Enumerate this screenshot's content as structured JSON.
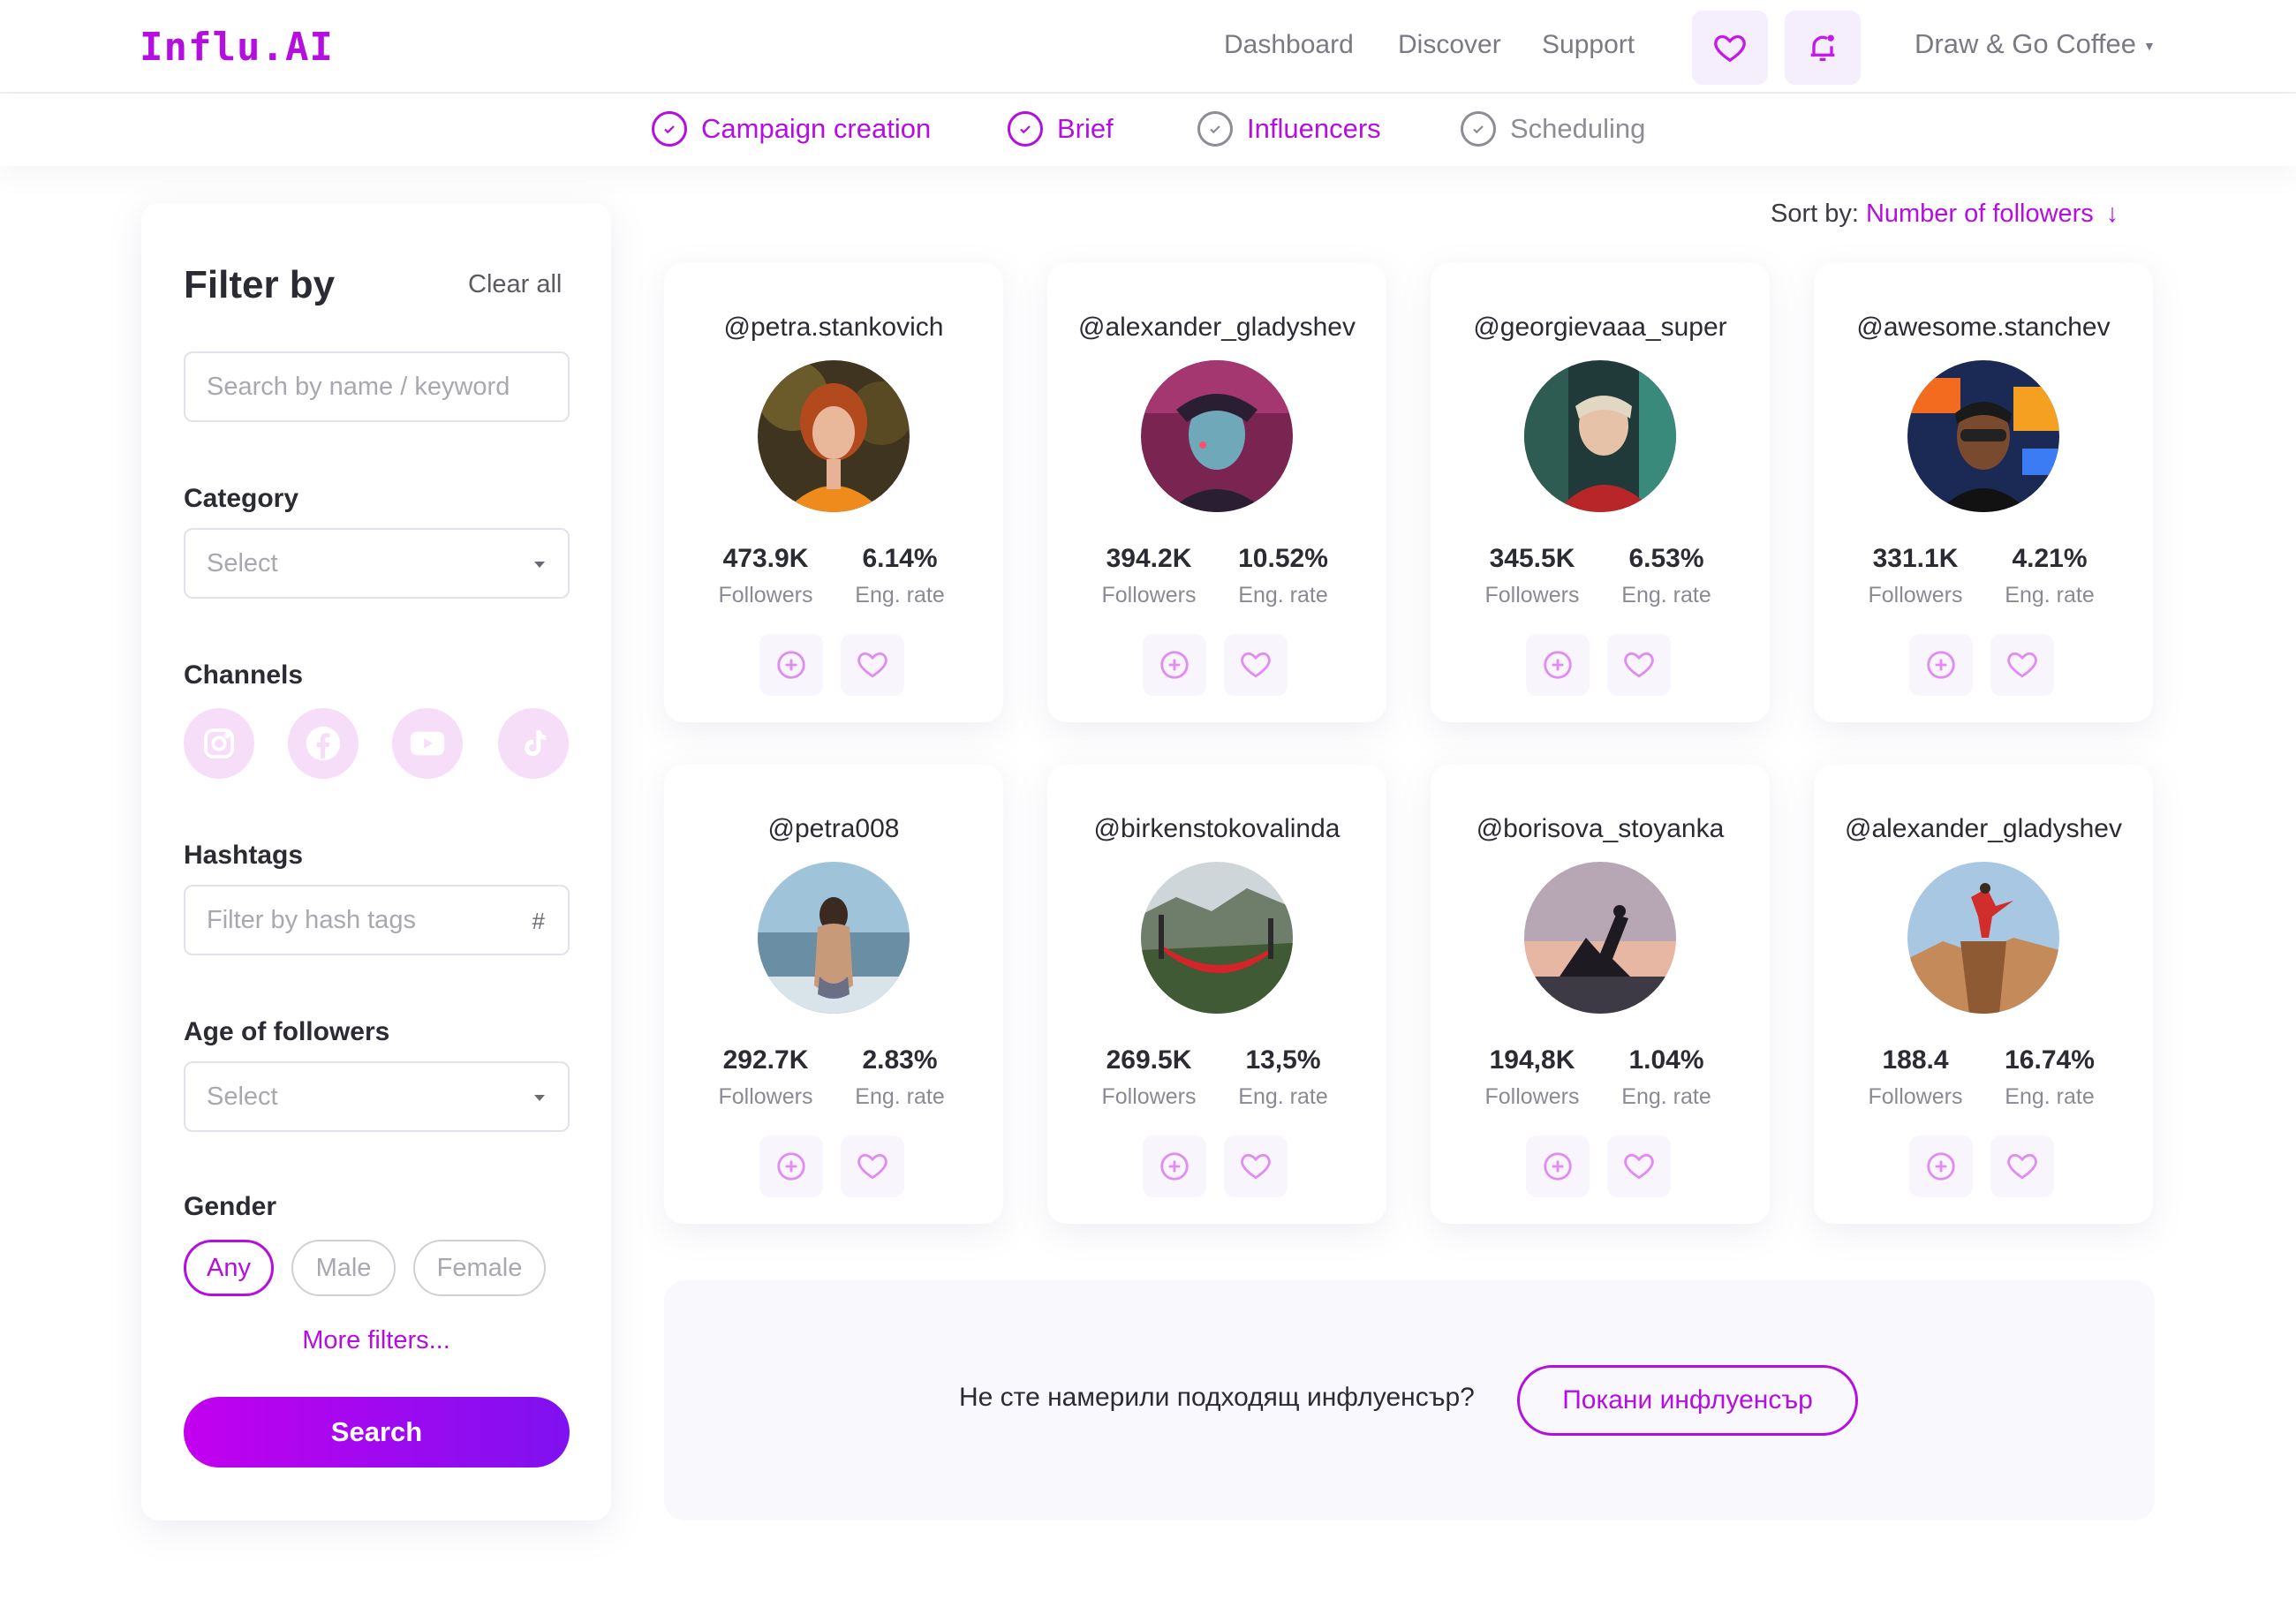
{
  "header": {
    "logo": "Influ.AI",
    "nav": [
      "Dashboard",
      "Discover",
      "Support"
    ],
    "account": "Draw & Go Coffee"
  },
  "steps": [
    {
      "label": "Campaign creation",
      "state": "done"
    },
    {
      "label": "Brief",
      "state": "done"
    },
    {
      "label": "Influencers",
      "state": "current"
    },
    {
      "label": "Scheduling",
      "state": "pending"
    }
  ],
  "filters": {
    "title": "Filter by",
    "clear_all": "Clear all",
    "search_placeholder": "Search by name / keyword",
    "category_label": "Category",
    "category_value": "Select",
    "channels_label": "Channels",
    "channels": [
      "instagram-icon",
      "facebook-icon",
      "youtube-icon",
      "tiktok-icon"
    ],
    "hashtags_label": "Hashtags",
    "hashtags_placeholder": "Filter by hash tags",
    "hashtags_suffix": "#",
    "age_label": "Age of followers",
    "age_value": "Select",
    "gender_label": "Gender",
    "gender_options": [
      "Any",
      "Male",
      "Female"
    ],
    "gender_selected": "Any",
    "more_filters": "More filters...",
    "search_button": "Search"
  },
  "sort": {
    "label": "Sort by:",
    "value": "Number of followers",
    "arrow": "↓"
  },
  "influencers": [
    {
      "handle": "@petra.stankovich",
      "followers": "473.9K",
      "followers_label": "Followers",
      "eng": "6.14%",
      "eng_label": "Eng. rate"
    },
    {
      "handle": "@alexander_gladyshev",
      "followers": "394.2K",
      "followers_label": "Followers",
      "eng": "10.52%",
      "eng_label": "Eng. rate"
    },
    {
      "handle": "@georgievaaa_super",
      "followers": "345.5K",
      "followers_label": "Followers",
      "eng": "6.53%",
      "eng_label": "Eng. rate"
    },
    {
      "handle": "@awesome.stanchev",
      "followers": "331.1K",
      "followers_label": "Followers",
      "eng": "4.21%",
      "eng_label": "Eng. rate"
    },
    {
      "handle": "@petra008",
      "followers": "292.7K",
      "followers_label": "Followers",
      "eng": "2.83%",
      "eng_label": "Eng. rate"
    },
    {
      "handle": "@birkenstokovalinda",
      "followers": "269.5K",
      "followers_label": "Followers",
      "eng": "13,5%",
      "eng_label": "Eng. rate"
    },
    {
      "handle": "@borisova_stoyanka",
      "followers": "194,8K",
      "followers_label": "Followers",
      "eng": "1.04%",
      "eng_label": "Eng. rate"
    },
    {
      "handle": "@alexander_gladyshev",
      "followers": "188.4",
      "followers_label": "Followers",
      "eng": "16.74%",
      "eng_label": "Eng. rate"
    }
  ],
  "invite": {
    "text": "Не сте намерили подходящ инфлуенсър?",
    "button": "Покани инфлуенсър"
  },
  "colors": {
    "accent": "#b40ee0",
    "accent_light": "#f6def8",
    "muted": "#8d8d96"
  }
}
